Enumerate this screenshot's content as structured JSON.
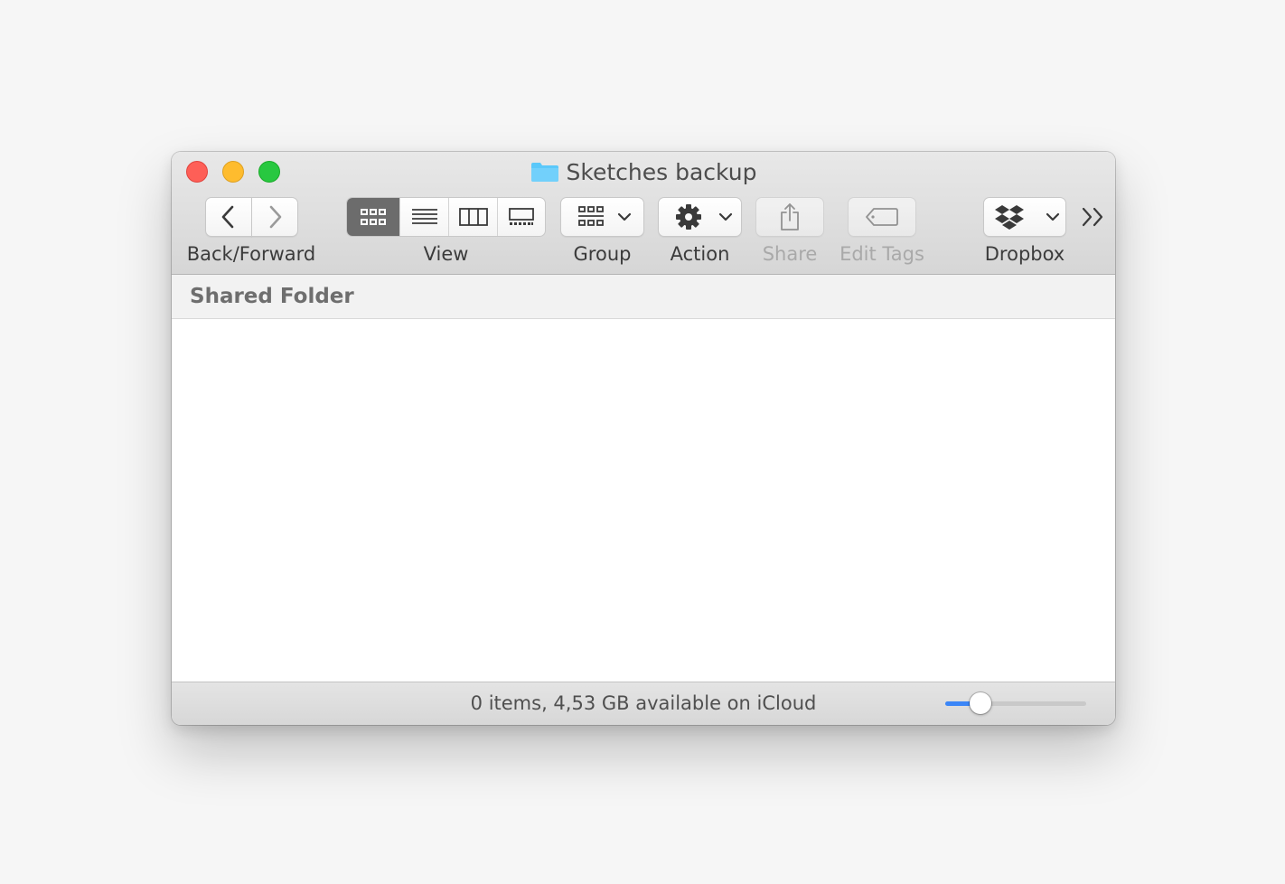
{
  "window": {
    "title": "Sketches backup",
    "folder_color": "#5ac8fa"
  },
  "toolbar": {
    "back_forward_label": "Back/Forward",
    "view_label": "View",
    "group_label": "Group",
    "action_label": "Action",
    "share_label": "Share",
    "edit_tags_label": "Edit Tags",
    "dropbox_label": "Dropbox",
    "view_modes": [
      "icon",
      "list",
      "column",
      "gallery"
    ],
    "active_view_mode": "icon"
  },
  "pathbar": {
    "label": "Shared Folder"
  },
  "status": {
    "text": "0 items, 4,53 GB available on iCloud",
    "icon_size_slider": 0.25,
    "accent_color": "#3b86f7"
  }
}
